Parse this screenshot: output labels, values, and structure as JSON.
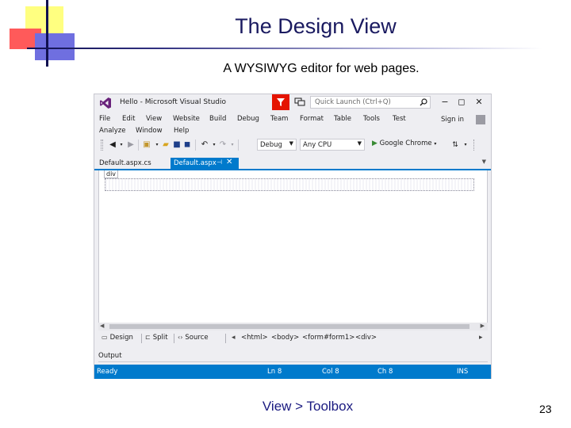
{
  "slide": {
    "title": "The Design View",
    "subtitle": "A WYSIWYG editor for web pages.",
    "caption": "View > Toolbox",
    "page_number": "23"
  },
  "window": {
    "title": "Hello - Microsoft Visual Studio",
    "quick_launch_placeholder": "Quick Launch (Ctrl+Q)",
    "minimize": "−",
    "restore": "◻",
    "close": "✕",
    "sign_in": "Sign in"
  },
  "menu": {
    "row1": [
      "File",
      "Edit",
      "View",
      "Website",
      "Build",
      "Debug",
      "Team",
      "Format",
      "Table",
      "Tools",
      "Test"
    ],
    "row2": [
      "Analyze",
      "Window",
      "Help"
    ]
  },
  "toolbar": {
    "configuration": "Debug",
    "platform": "Any CPU",
    "run_target": "Google Chrome"
  },
  "tabs": {
    "inactive": "Default.aspx.cs",
    "active": "Default.aspx",
    "pin": "⊣",
    "close": "✕"
  },
  "editor": {
    "div_label": "div"
  },
  "viewbar": {
    "design": "Design",
    "split": "Split",
    "source": "Source",
    "breadcrumbs": [
      "<html>",
      "<body>",
      "<form#form1>",
      "<div>"
    ]
  },
  "output": {
    "label": "Output"
  },
  "status": {
    "ready": "Ready",
    "line": "Ln 8",
    "col": "Col 8",
    "ch": "Ch 8",
    "mode": "INS"
  },
  "colors": {
    "accent": "#007acc",
    "filter": "#e51400",
    "vs_purple": "#68217a",
    "title_text": "#1a1a60"
  }
}
